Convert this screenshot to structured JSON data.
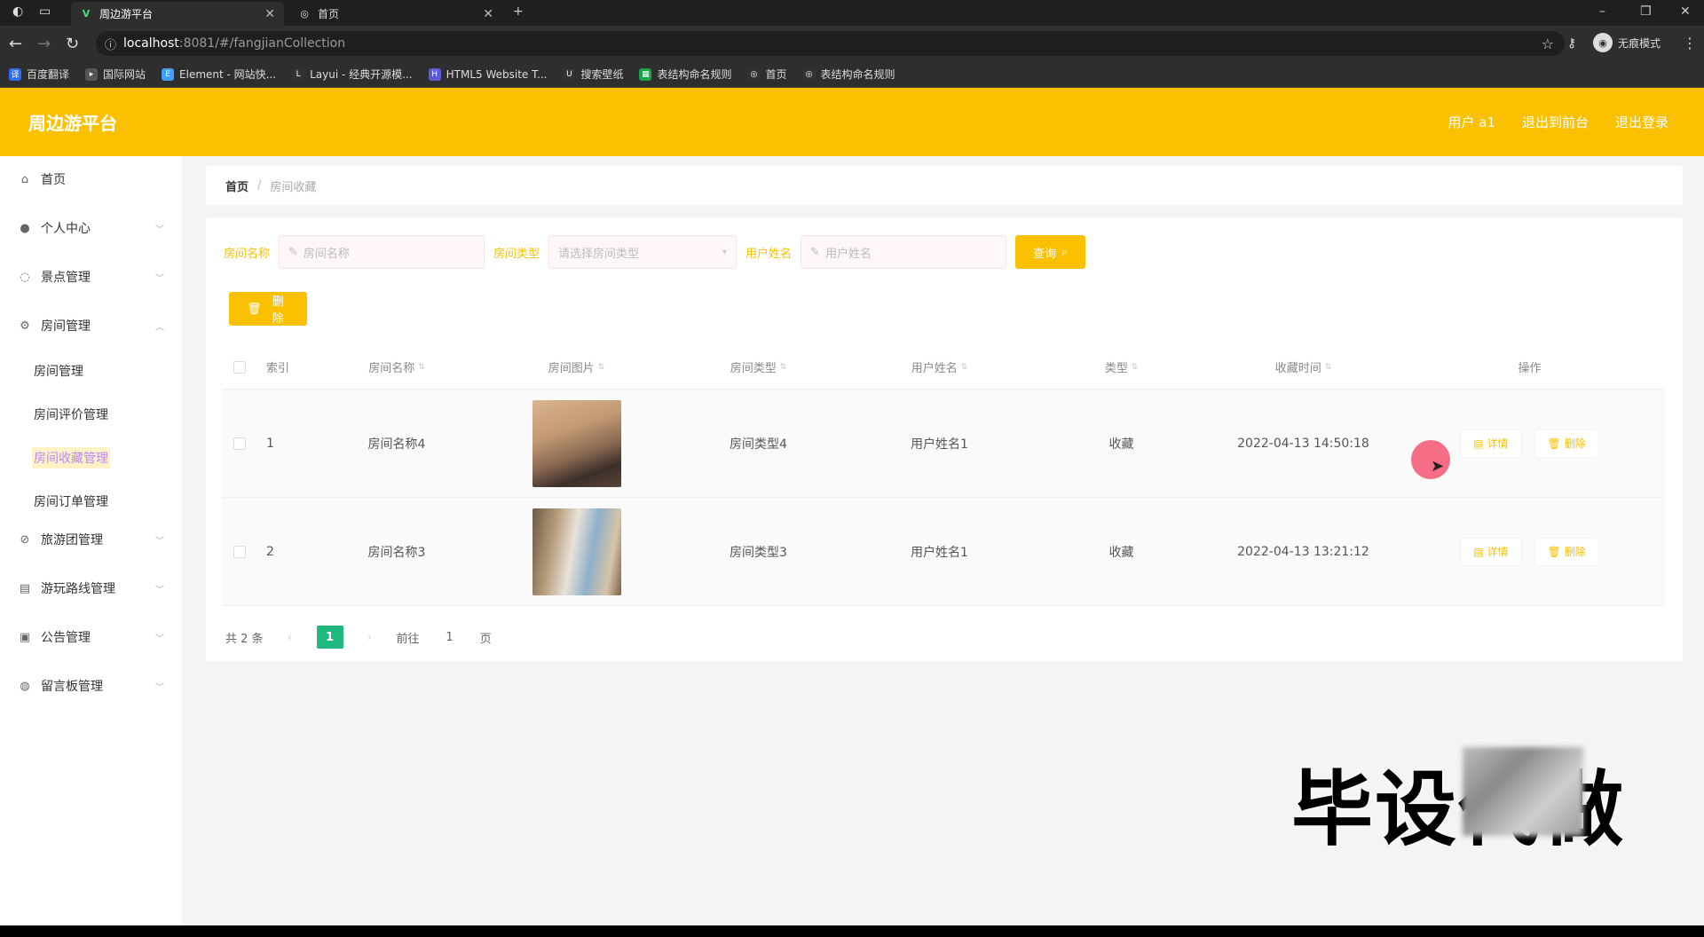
{
  "browser": {
    "tabs": [
      {
        "title": "周边游平台",
        "active": true,
        "favicon": "V"
      },
      {
        "title": "首页",
        "active": false,
        "favicon": "globe"
      }
    ],
    "new_tab": "+",
    "url_host": "localhost",
    "url_path": ":8081/#/fangjianCollection",
    "incognito_label": "无痕模式",
    "bookmarks": [
      {
        "label": "百度翻译",
        "color": "#2d6cf6"
      },
      {
        "label": "国际网站",
        "color": "#555555"
      },
      {
        "label": "Element - 网站快...",
        "color": "#409eff"
      },
      {
        "label": "Layui - 经典开源模...",
        "color": "#333333"
      },
      {
        "label": "HTML5 Website T...",
        "color": "#5b5bd6"
      },
      {
        "label": "搜索壁纸",
        "color": "#333333"
      },
      {
        "label": "表结构命名规则",
        "color": "#16a34a"
      },
      {
        "label": "首页",
        "color": "#333333"
      },
      {
        "label": "表结构命名规则",
        "color": "#333333"
      }
    ]
  },
  "app": {
    "brand": "周边游平台",
    "top_links": [
      "用户 a1",
      "退出到前台",
      "退出登录"
    ],
    "accent_color": "#fbc101"
  },
  "sidebar": {
    "items": [
      {
        "label": "首页",
        "icon": "home-icon",
        "has_children": false
      },
      {
        "label": "个人中心",
        "icon": "user-icon",
        "has_children": true
      },
      {
        "label": "景点管理",
        "icon": "circle-icon",
        "has_children": true
      },
      {
        "label": "房间管理",
        "icon": "gear-icon",
        "has_children": true
      },
      {
        "label": "旅游团管理",
        "icon": "compass-icon",
        "has_children": true
      },
      {
        "label": "游玩路线管理",
        "icon": "stack-icon",
        "has_children": true
      },
      {
        "label": "公告管理",
        "icon": "notice-icon",
        "has_children": true
      },
      {
        "label": "留言板管理",
        "icon": "message-icon",
        "has_children": true
      }
    ],
    "sub_items": [
      {
        "label": "房间管理",
        "active": false
      },
      {
        "label": "房间评价管理",
        "active": false
      },
      {
        "label": "房间收藏管理",
        "active": true
      },
      {
        "label": "房间订单管理",
        "active": false
      }
    ]
  },
  "breadcrumb": {
    "home": "首页",
    "separator": "/",
    "current": "房间收藏"
  },
  "filters": {
    "name_label": "房间名称",
    "name_placeholder": "房间名称",
    "type_label": "房间类型",
    "type_placeholder": "请选择房间类型",
    "user_label": "用户姓名",
    "user_placeholder": "用户姓名",
    "search_button": "查询"
  },
  "batch_delete": "删除",
  "table": {
    "columns": [
      "索引",
      "房间名称",
      "房间图片",
      "房间类型",
      "用户姓名",
      "类型",
      "收藏时间",
      "操作"
    ],
    "rows": [
      {
        "index": "1",
        "name": "房间名称4",
        "type": "房间类型4",
        "user": "用户姓名1",
        "kind": "收藏",
        "time": "2022-04-13 14:50:18",
        "detail": "详情",
        "delete": "删除"
      },
      {
        "index": "2",
        "name": "房间名称3",
        "type": "房间类型3",
        "user": "用户姓名1",
        "kind": "收藏",
        "time": "2022-04-13 13:21:12",
        "detail": "详情",
        "delete": "删除"
      }
    ]
  },
  "pagination": {
    "total": "共 2 条",
    "current": "1",
    "goto_label": "前往",
    "goto_value": "1",
    "page_unit": "页"
  },
  "watermark": "毕设代做"
}
